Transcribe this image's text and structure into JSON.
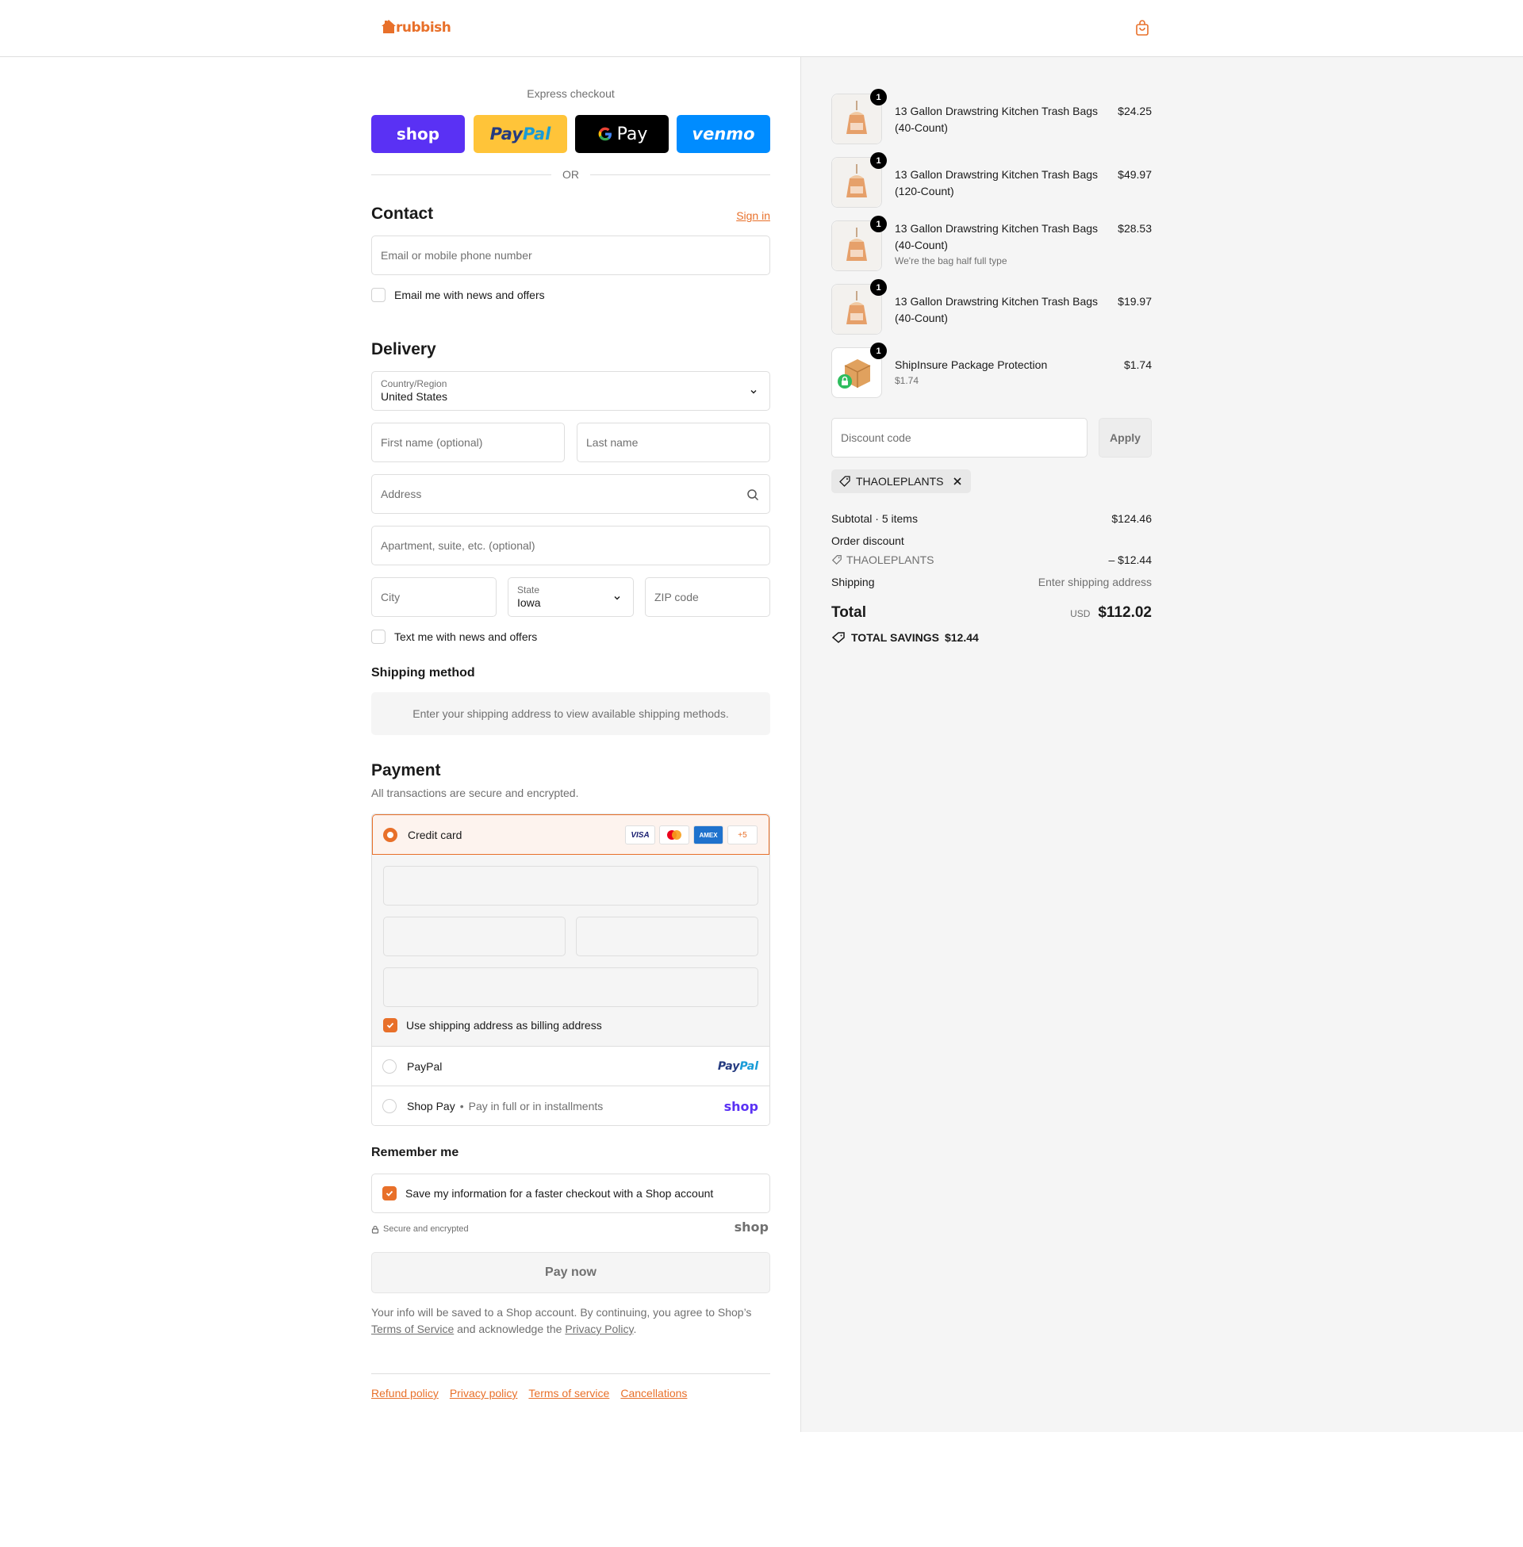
{
  "brand": {
    "name": "rubbish",
    "accent": "#e8702a"
  },
  "express": {
    "title": "Express checkout",
    "buttons": {
      "shop": "shop",
      "paypal_a": "Pay",
      "paypal_b": "Pal",
      "gpay": "Pay",
      "venmo": "venmo"
    },
    "or": "OR"
  },
  "contact": {
    "title": "Contact",
    "sign_in": "Sign in",
    "email_placeholder": "Email or mobile phone number",
    "news_label": "Email me with news and offers"
  },
  "delivery": {
    "title": "Delivery",
    "country_label": "Country/Region",
    "country_value": "United States",
    "first_name": "First name (optional)",
    "last_name": "Last name",
    "address": "Address",
    "apartment": "Apartment, suite, etc. (optional)",
    "city": "City",
    "state_label": "State",
    "state_value": "Iowa",
    "zip": "ZIP code",
    "text_label": "Text me with news and offers"
  },
  "shipping_method": {
    "title": "Shipping method",
    "message": "Enter your shipping address to view available shipping methods."
  },
  "payment": {
    "title": "Payment",
    "subtitle": "All transactions are secure and encrypted.",
    "credit_card": "Credit card",
    "card_logos": [
      "VISA",
      "",
      "AMEX",
      "+5"
    ],
    "billing_label": "Use shipping address as billing address",
    "paypal_label": "PayPal",
    "paypal_logo_a": "Pay",
    "paypal_logo_b": "Pal",
    "shoppay_label": "Shop Pay",
    "shoppay_note": "Pay in full or in installments",
    "shop_logo": "shop"
  },
  "remember": {
    "title": "Remember me",
    "save_label": "Save my information for a faster checkout with a Shop account",
    "secure": "Secure and encrypted",
    "shop_logo": "shop"
  },
  "pay_now": "Pay now",
  "legal": {
    "line1": "Your info will be saved to a Shop account. By continuing, you agree to Shop’s",
    "tos": "Terms of Service",
    "mid": "and acknowledge the",
    "privacy": "Privacy Policy",
    "end": "."
  },
  "footer_links": [
    "Refund policy",
    "Privacy policy",
    "Terms of service",
    "Cancellations"
  ],
  "cart": {
    "items": [
      {
        "name": "13 Gallon Drawstring Kitchen Trash Bags (40-Count)",
        "sub": "",
        "price": "$24.25",
        "qty": "1"
      },
      {
        "name": "13 Gallon Drawstring Kitchen Trash Bags (120-Count)",
        "sub": "",
        "price": "$49.97",
        "qty": "1"
      },
      {
        "name": "13 Gallon Drawstring Kitchen Trash Bags (40-Count)",
        "sub": "We're the bag half full type",
        "price": "$28.53",
        "qty": "1"
      },
      {
        "name": "13 Gallon Drawstring Kitchen Trash Bags (40-Count)",
        "sub": "",
        "price": "$19.97",
        "qty": "1"
      },
      {
        "name": "ShipInsure Package Protection",
        "sub": "$1.74",
        "price": "$1.74",
        "qty": "1"
      }
    ],
    "discount_placeholder": "Discount code",
    "apply": "Apply",
    "applied_code": "THAOLEPLANTS"
  },
  "totals": {
    "subtotal_label": "Subtotal · 5 items",
    "subtotal_value": "$124.46",
    "order_discount_label": "Order discount",
    "discount_code": "THAOLEPLANTS",
    "discount_value": "– $12.44",
    "shipping_label": "Shipping",
    "shipping_value": "Enter shipping address",
    "total_label": "Total",
    "currency": "USD",
    "total_value": "$112.02",
    "savings_label": "TOTAL SAVINGS",
    "savings_value": "$12.44"
  }
}
